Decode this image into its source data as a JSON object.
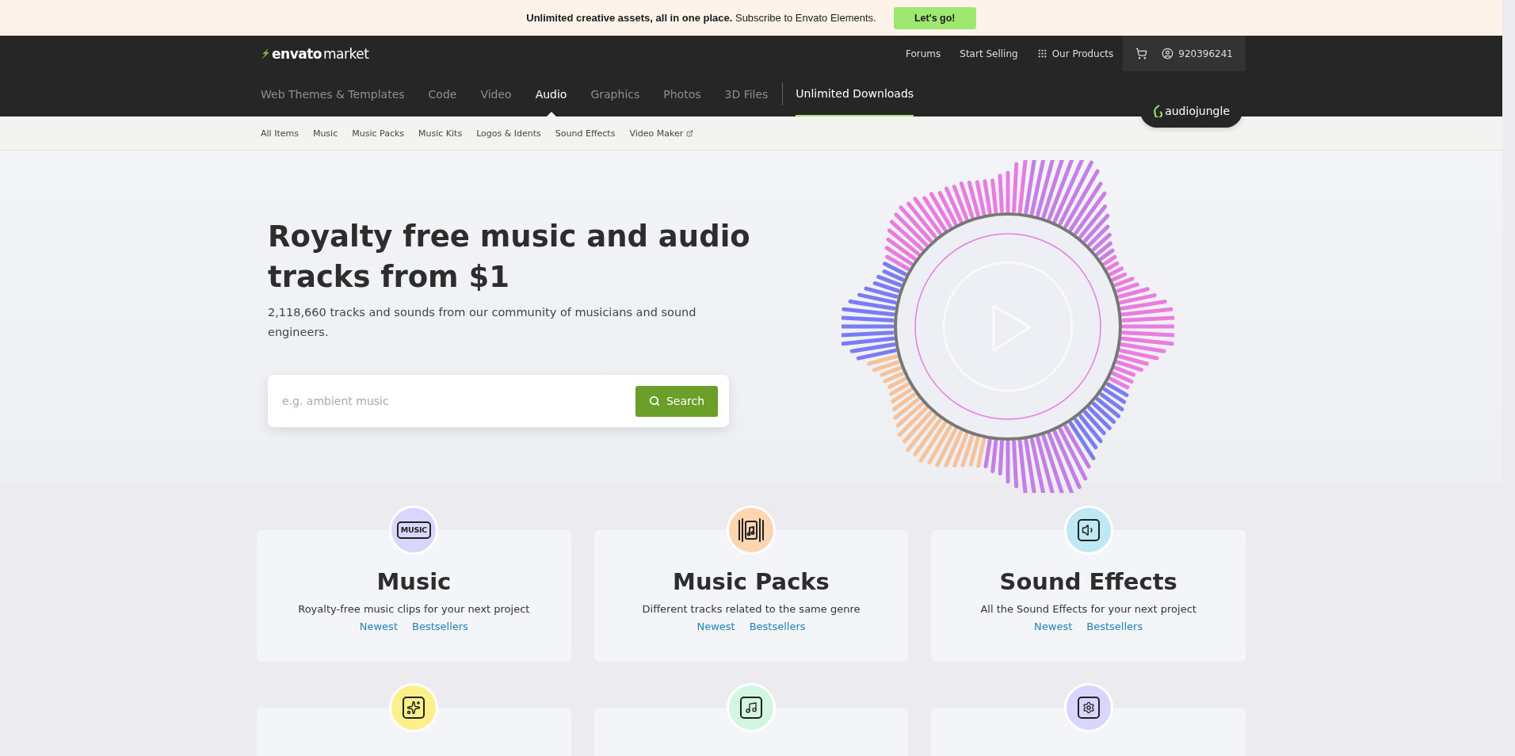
{
  "banner": {
    "text": "**Unlimited creative assets, all in one place.** Subscribe to Envato Elements.",
    "button": "Let's go!"
  },
  "header": {
    "logo": {
      "brand": "envato",
      "suffix": "market"
    },
    "links": [
      "Forums",
      "Start Selling"
    ],
    "products": "Our Products",
    "account": "920396241",
    "categories": [
      {
        "label": "Web Themes & Templates",
        "selected": false
      },
      {
        "label": "Code",
        "selected": false
      },
      {
        "label": "Video",
        "selected": false
      },
      {
        "label": "Audio",
        "selected": true
      },
      {
        "label": "Graphics",
        "selected": false
      },
      {
        "label": "Photos",
        "selected": false
      },
      {
        "label": "3D Files",
        "selected": false
      }
    ],
    "unlimited": "Unlimited Downloads",
    "site_badge": "audiojungle"
  },
  "sub_nav": [
    {
      "label": "All Items",
      "external": false
    },
    {
      "label": "Music",
      "external": false
    },
    {
      "label": "Music Packs",
      "external": false
    },
    {
      "label": "Music Kits",
      "external": false
    },
    {
      "label": "Logos & Idents",
      "external": false
    },
    {
      "label": "Sound Effects",
      "external": false
    },
    {
      "label": "Video Maker",
      "external": true
    }
  ],
  "hero": {
    "title": "Royalty free music and audio tracks from $1",
    "subtitle": "2,118,660 tracks and sounds from our community of musicians and sound engineers.",
    "search": {
      "placeholder": "e.g. ambient music",
      "button": "Search"
    }
  },
  "cards": [
    {
      "kind": "label",
      "icon_text": "MUSIC",
      "color": "#d8d6fd",
      "title": "Music",
      "description": "Royalty-free music clips for your next project",
      "links": [
        "Newest",
        "Bestsellers"
      ]
    },
    {
      "kind": "packs",
      "color": "#fdd5b1",
      "title": "Music Packs",
      "description": "Different tracks related to the same genre",
      "links": [
        "Newest",
        "Bestsellers"
      ]
    },
    {
      "kind": "sound",
      "color": "#bfe8f5",
      "title": "Sound Effects",
      "description": "All the Sound Effects for your next project",
      "links": [
        "Newest",
        "Bestsellers"
      ]
    },
    {
      "kind": "sparkle",
      "color": "#fbf08a"
    },
    {
      "kind": "note",
      "color": "#d3f6e3"
    },
    {
      "kind": "file-gear",
      "color": "#d8d6fd"
    }
  ]
}
